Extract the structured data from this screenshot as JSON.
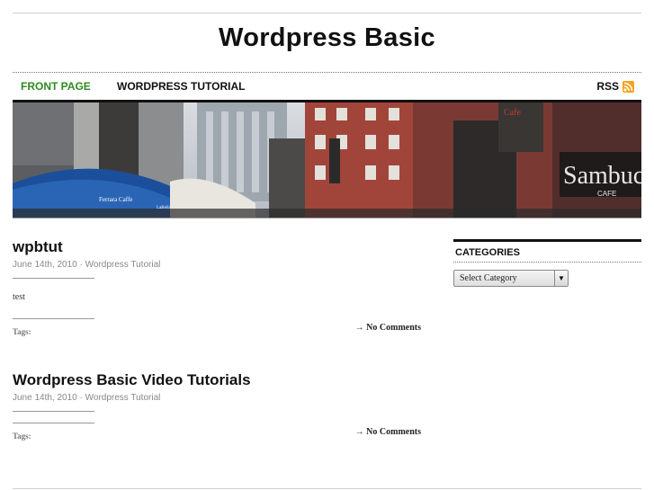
{
  "site": {
    "title": "Wordpress Basic"
  },
  "nav": {
    "items": [
      {
        "label": "FRONT PAGE"
      },
      {
        "label": "WORDPRESS TUTORIAL"
      }
    ],
    "rss_label": "RSS"
  },
  "banner": {
    "signs": {
      "ferrara": "Ferrara Caffe",
      "labella": "LaBella Ferrara Caffe",
      "cafe": "Cafe",
      "sambuca": "Sambuca",
      "sambuca_sub": "CAFE"
    }
  },
  "posts": [
    {
      "title": "wpbtut",
      "date": "June 14th, 2010",
      "separator": " · ",
      "category": "Wordpress Tutorial",
      "body": "test",
      "tags_label": "Tags:",
      "comments": "No Comments",
      "comments_arrow": "→"
    },
    {
      "title": "Wordpress Basic Video Tutorials",
      "date": "June 14th, 2010",
      "separator": " · ",
      "category": "Wordpress Tutorial",
      "body": "",
      "tags_label": "Tags:",
      "comments": "No Comments",
      "comments_arrow": "→"
    }
  ],
  "sidebar": {
    "categories_heading": "CATEGORIES",
    "select_value": "Select Category",
    "select_arrow": "▼"
  },
  "colors": {
    "nav_active": "#2e8b1f",
    "rss": "#f7a21b"
  }
}
